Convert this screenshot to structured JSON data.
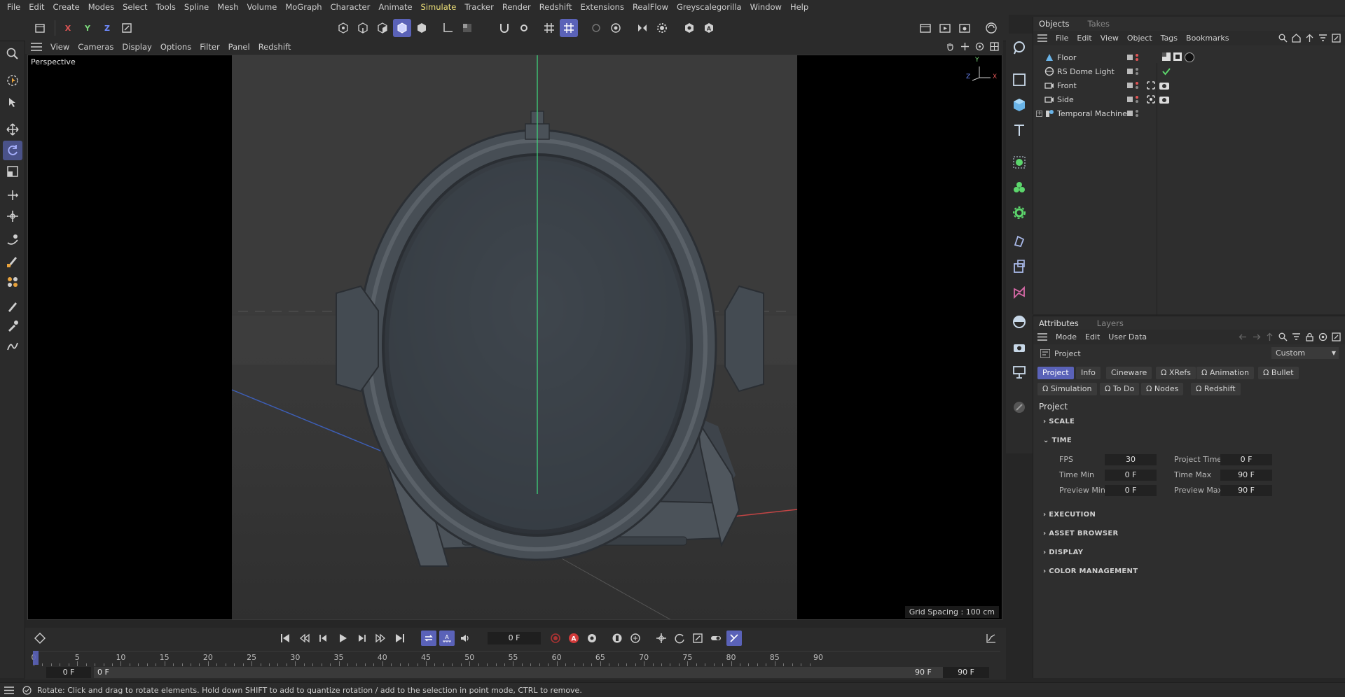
{
  "menubar": [
    "File",
    "Edit",
    "Create",
    "Modes",
    "Select",
    "Tools",
    "Spline",
    "Mesh",
    "Volume",
    "MoGraph",
    "Character",
    "Animate",
    "Simulate",
    "Tracker",
    "Render",
    "Redshift",
    "Extensions",
    "RealFlow",
    "Greyscalegorilla",
    "Window",
    "Help"
  ],
  "menubar_active": "Simulate",
  "toolbar": {
    "x_axis": "X",
    "y_axis": "Y",
    "z_axis": "Z"
  },
  "viewport": {
    "menu": [
      "View",
      "Cameras",
      "Display",
      "Options",
      "Filter",
      "Panel",
      "Redshift"
    ],
    "label": "Perspective",
    "grid_spacing": "Grid Spacing : 100 cm",
    "axis_x": "X",
    "axis_y": "Y",
    "axis_z": "Z"
  },
  "objects": {
    "tabs": [
      "Objects",
      "Takes"
    ],
    "menu": [
      "File",
      "Edit",
      "View",
      "Object",
      "Tags",
      "Bookmarks"
    ],
    "items": [
      {
        "name": "Floor",
        "icon": "floor-icon"
      },
      {
        "name": "RS Dome Light",
        "icon": "dome-light-icon"
      },
      {
        "name": "Front",
        "icon": "camera-icon"
      },
      {
        "name": "Side",
        "icon": "camera-icon"
      },
      {
        "name": "Temporal Machine",
        "icon": "null-object-icon"
      }
    ]
  },
  "attributes": {
    "tabs": [
      "Attributes",
      "Layers"
    ],
    "menu": [
      "Mode",
      "Edit",
      "User Data"
    ],
    "header": "Project",
    "preset": "Custom",
    "chips_row1": [
      "Project",
      "Info",
      "Cineware",
      "XRefs",
      "Animation",
      "Bullet"
    ],
    "chips_row2": [
      "Simulation",
      "To Do",
      "Nodes",
      "Redshift"
    ],
    "section_title": "Project",
    "sections": [
      "SCALE",
      "TIME",
      "EXECUTION",
      "ASSET BROWSER",
      "DISPLAY",
      "COLOR MANAGEMENT"
    ],
    "time": {
      "fps_label": "FPS",
      "fps": "30",
      "project_time_label": "Project Time",
      "project_time": "0 F",
      "time_min_label": "Time Min",
      "time_min": "0 F",
      "time_max_label": "Time Max",
      "time_max": "90 F",
      "preview_min_label": "Preview Min",
      "preview_min": "0 F",
      "preview_max_label": "Preview Max",
      "preview_max": "90 F"
    }
  },
  "timeline": {
    "current_frame": "0 F",
    "ticks": [
      "0",
      "5",
      "10",
      "15",
      "20",
      "25",
      "30",
      "35",
      "40",
      "45",
      "50",
      "55",
      "60",
      "65",
      "70",
      "75",
      "80",
      "85",
      "90"
    ],
    "range_start": "0 F",
    "range_start2": "0 F",
    "range_end": "90 F",
    "range_end2": "90 F"
  },
  "status": "Rotate: Click and drag to rotate elements. Hold down SHIFT to add to quantize rotation / add to the selection in point mode, CTRL to remove.",
  "colors": {
    "accent": "#5a62b8",
    "x_axis": "#e05555",
    "y_axis": "#7ad67a",
    "z_axis": "#5577dd"
  }
}
